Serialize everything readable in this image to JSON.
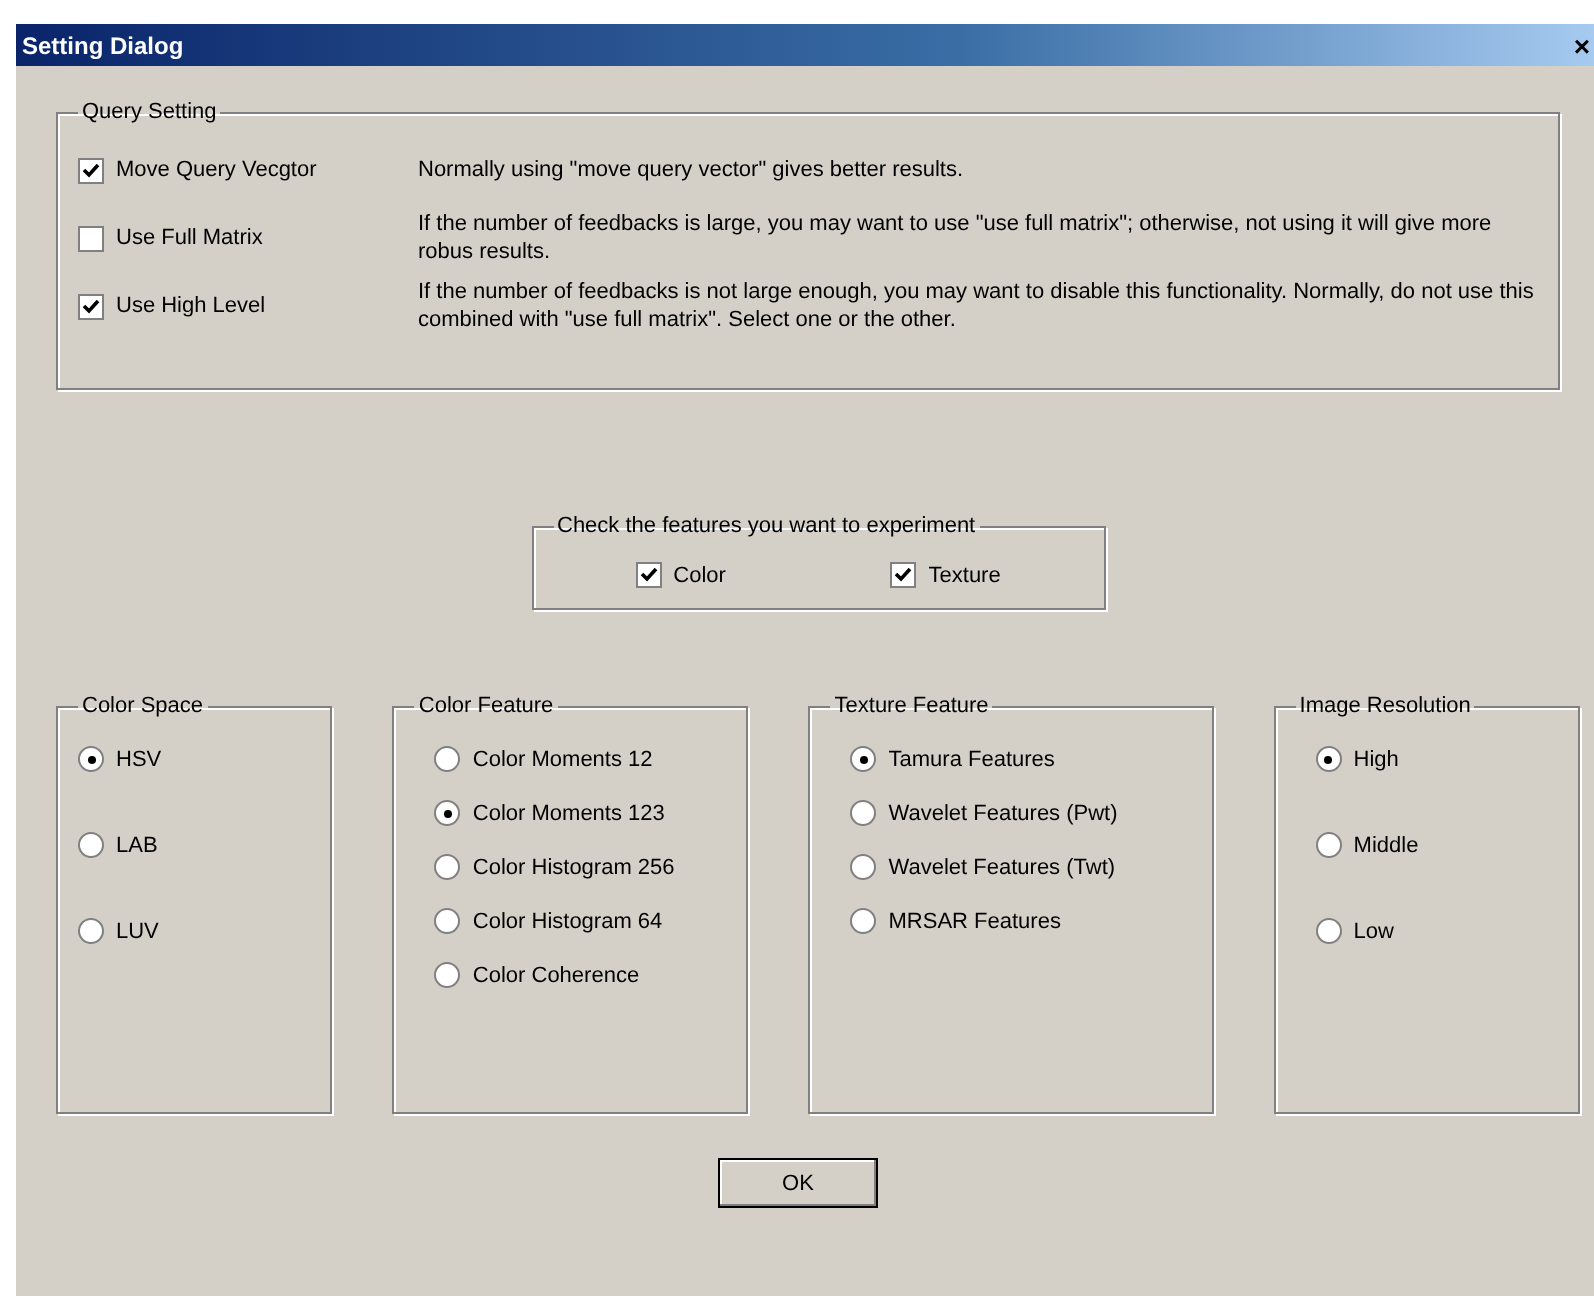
{
  "window": {
    "title": "Setting Dialog",
    "close": "×"
  },
  "query_setting": {
    "title": "Query Setting",
    "options": [
      {
        "label": "Move Query Vecgtor",
        "checked": true,
        "description": "Normally using \"move query vector\" gives better results."
      },
      {
        "label": "Use Full Matrix",
        "checked": false,
        "description": "If the number of feedbacks is large, you may want to use \"use full matrix\"; otherwise, not using it will give more robus results."
      },
      {
        "label": "Use High Level",
        "checked": true,
        "description": "If the number of feedbacks is not large enough, you may want to disable this functionality.  Normally, do not use this combined with \"use full matrix\".  Select one or the other."
      }
    ]
  },
  "features": {
    "title": "Check the features you want to experiment",
    "options": [
      {
        "label": "Color",
        "checked": true
      },
      {
        "label": "Texture",
        "checked": true
      }
    ]
  },
  "groups": [
    {
      "title": "Color Space",
      "options": [
        {
          "label": "HSV",
          "selected": true
        },
        {
          "label": "LAB",
          "selected": false
        },
        {
          "label": "LUV",
          "selected": false
        }
      ]
    },
    {
      "title": "Color Feature",
      "options": [
        {
          "label": "Color Moments 12",
          "selected": false
        },
        {
          "label": "Color Moments 123",
          "selected": true
        },
        {
          "label": "Color Histogram 256",
          "selected": false
        },
        {
          "label": "Color Histogram 64",
          "selected": false
        },
        {
          "label": "Color Coherence",
          "selected": false
        }
      ]
    },
    {
      "title": "Texture Feature",
      "options": [
        {
          "label": "Tamura Features",
          "selected": true
        },
        {
          "label": "Wavelet Features (Pwt)",
          "selected": false
        },
        {
          "label": "Wavelet Features (Twt)",
          "selected": false
        },
        {
          "label": "MRSAR Features",
          "selected": false
        }
      ]
    },
    {
      "title": "Image Resolution",
      "options": [
        {
          "label": "High",
          "selected": true
        },
        {
          "label": "Middle",
          "selected": false
        },
        {
          "label": "Low",
          "selected": false
        }
      ]
    }
  ],
  "ok_button": "OK"
}
